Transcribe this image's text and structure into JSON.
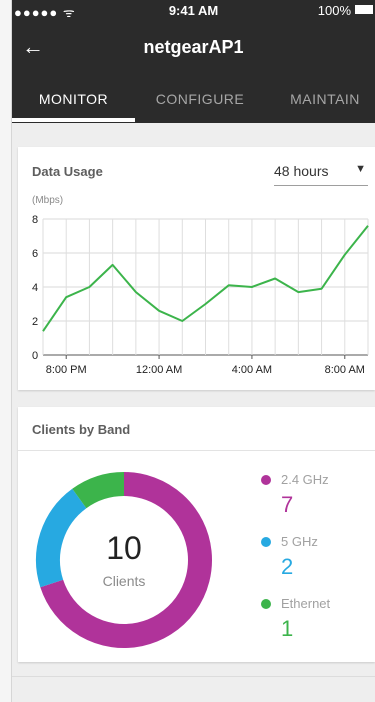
{
  "status_bar": {
    "signal": "●●●●● ᯤ",
    "time": "9:41 AM",
    "battery": "100%"
  },
  "nav": {
    "title": "netgearAP1"
  },
  "tabs": [
    {
      "label": "MONITOR",
      "active": true
    },
    {
      "label": "CONFIGURE",
      "active": false
    },
    {
      "label": "MAINTAIN",
      "active": false
    }
  ],
  "data_usage": {
    "title": "Data Usage",
    "range": "48 hours",
    "unit": "(Mbps)"
  },
  "chart_data": {
    "type": "line",
    "ylabel": "(Mbps)",
    "ylim": [
      0,
      8
    ],
    "yticks": [
      "0",
      "2",
      "4",
      "6",
      "8"
    ],
    "xticks": [
      {
        "label": "8:00 PM",
        "x": 1
      },
      {
        "label": "12:00 AM",
        "x": 5
      },
      {
        "label": "4:00 AM",
        "x": 9
      },
      {
        "label": "8:00 AM",
        "x": 13
      }
    ],
    "grid": true,
    "color": "#3cb44b",
    "series": [
      {
        "x": [
          0,
          1,
          2,
          3,
          4,
          5,
          6,
          7,
          8,
          9,
          10,
          11,
          12,
          13,
          14
        ],
        "y": [
          1.4,
          3.4,
          4.0,
          5.3,
          3.7,
          2.6,
          2.0,
          3.0,
          4.1,
          4.0,
          4.5,
          3.7,
          3.9,
          5.9,
          7.6
        ]
      }
    ]
  },
  "clients": {
    "title": "Clients by Band",
    "total": "10",
    "total_label": "Clients",
    "bands": [
      {
        "name": "2.4 GHz",
        "count": "7",
        "value": 7,
        "color": "#b0339a"
      },
      {
        "name": "5 GHz",
        "count": "2",
        "value": 2,
        "color": "#27a9e1"
      },
      {
        "name": "Ethernet",
        "count": "1",
        "value": 1,
        "color": "#3cb44b"
      }
    ]
  }
}
